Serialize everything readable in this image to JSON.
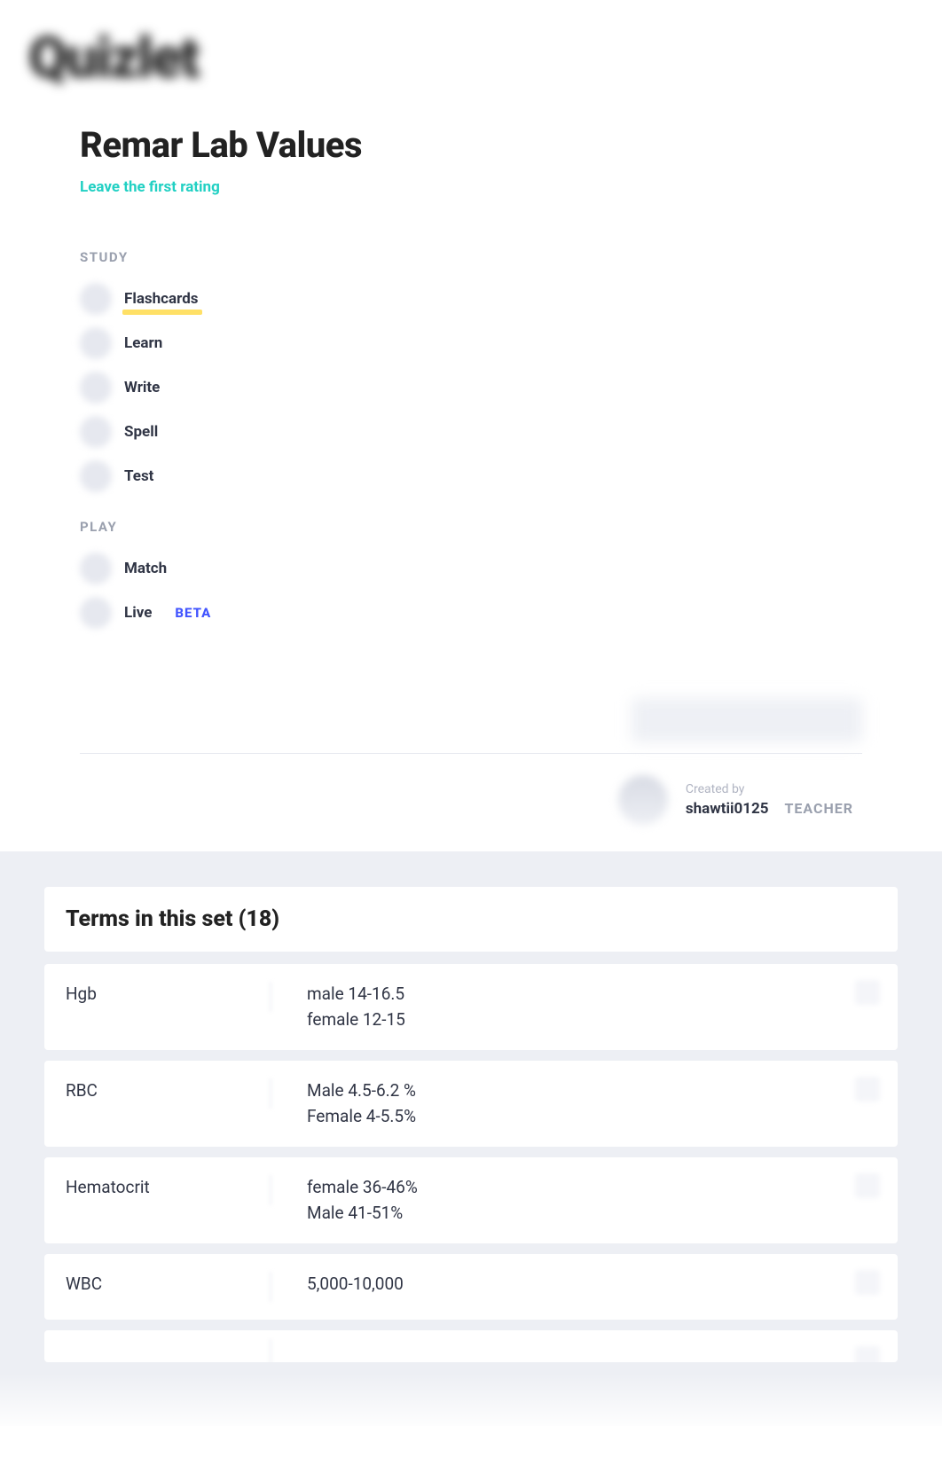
{
  "logo": "Quizlet",
  "title": "Remar Lab Values",
  "rating_link": "Leave the first rating",
  "sections": {
    "study_label": "STUDY",
    "play_label": "PLAY"
  },
  "study_items": [
    {
      "label": "Flashcards",
      "active": true
    },
    {
      "label": "Learn"
    },
    {
      "label": "Write"
    },
    {
      "label": "Spell"
    },
    {
      "label": "Test"
    }
  ],
  "play_items": [
    {
      "label": "Match"
    },
    {
      "label": "Live",
      "badge": "BETA"
    }
  ],
  "creator": {
    "created_by": "Created by",
    "name": "shawtii0125",
    "badge": "TEACHER"
  },
  "terms_header": "Terms in this set (18)",
  "terms": [
    {
      "term": "Hgb",
      "def": "male 14-16.5\nfemale 12-15"
    },
    {
      "term": "RBC",
      "def": "Male 4.5-6.2 %\nFemale 4-5.5%"
    },
    {
      "term": "Hematocrit",
      "def": "female 36-46%\nMale 41-51%"
    },
    {
      "term": "WBC",
      "def": "5,000-10,000"
    }
  ]
}
